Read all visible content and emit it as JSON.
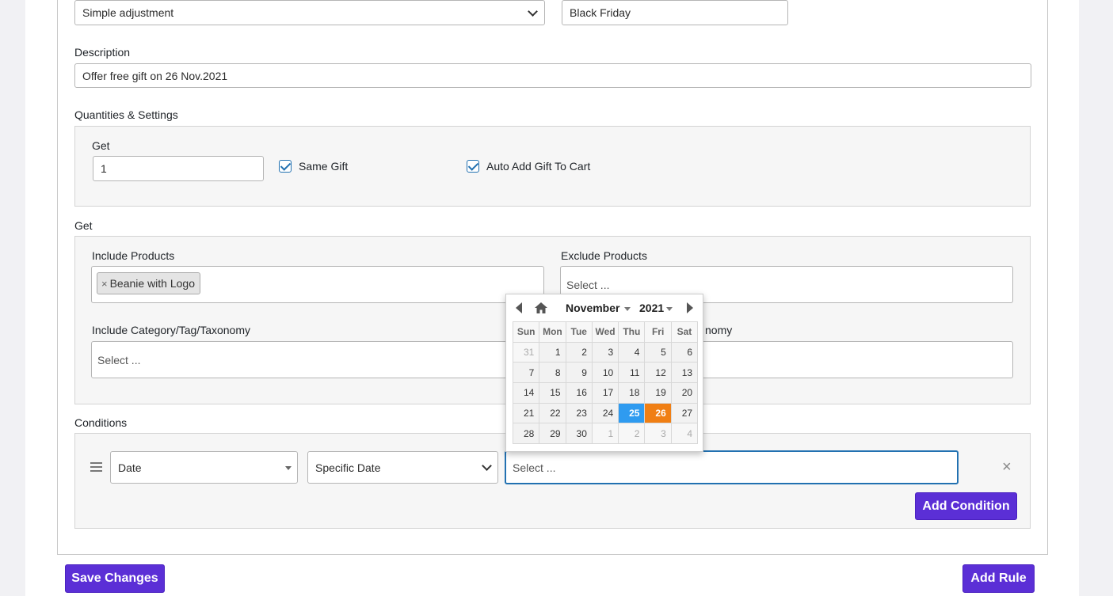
{
  "rule": {
    "type_select": "Simple adjustment",
    "title_value": "Black Friday",
    "description_label": "Description",
    "description_value": "Offer free gift on 26 Nov.2021"
  },
  "quantities": {
    "section_label": "Quantities & Settings",
    "get_label": "Get",
    "get_value": "1",
    "same_gift_label": "Same Gift",
    "same_gift_checked": true,
    "auto_add_label": "Auto Add Gift To Cart",
    "auto_add_checked": true
  },
  "get": {
    "section_label": "Get",
    "include_products_label": "Include Products",
    "include_products_tags": [
      "Beanie with Logo"
    ],
    "exclude_products_label": "Exclude Products",
    "exclude_products_placeholder": "Select ...",
    "include_taxonomy_label": "Include Category/Tag/Taxonomy",
    "include_taxonomy_placeholder": "Select ...",
    "exclude_taxonomy_label_partial": "nomy"
  },
  "conditions": {
    "section_label": "Conditions",
    "condition_type": "Date",
    "condition_operator": "Specific Date",
    "condition_value_placeholder": "Select ...",
    "add_condition_label": "Add Condition",
    "remove_icon": "close-icon"
  },
  "calendar": {
    "month": "November",
    "year": "2021",
    "weekdays": [
      "Sun",
      "Mon",
      "Tue",
      "Wed",
      "Thu",
      "Fri",
      "Sat"
    ],
    "weeks": [
      [
        "31",
        "1",
        "2",
        "3",
        "4",
        "5",
        "6"
      ],
      [
        "7",
        "8",
        "9",
        "10",
        "11",
        "12",
        "13"
      ],
      [
        "14",
        "15",
        "16",
        "17",
        "18",
        "19",
        "20"
      ],
      [
        "21",
        "22",
        "23",
        "24",
        "25",
        "26",
        "27"
      ],
      [
        "28",
        "29",
        "30",
        "1",
        "2",
        "3",
        "4"
      ]
    ],
    "today": "25",
    "selected": "26",
    "today_color": "#2f9bf0",
    "selected_color": "#f07f14"
  },
  "footer": {
    "save_label": "Save Changes",
    "add_rule_label": "Add Rule"
  },
  "colors": {
    "primary_button": "#5b2fd6",
    "checkbox_accent": "#2271b1",
    "focus_border": "#2271b1"
  }
}
